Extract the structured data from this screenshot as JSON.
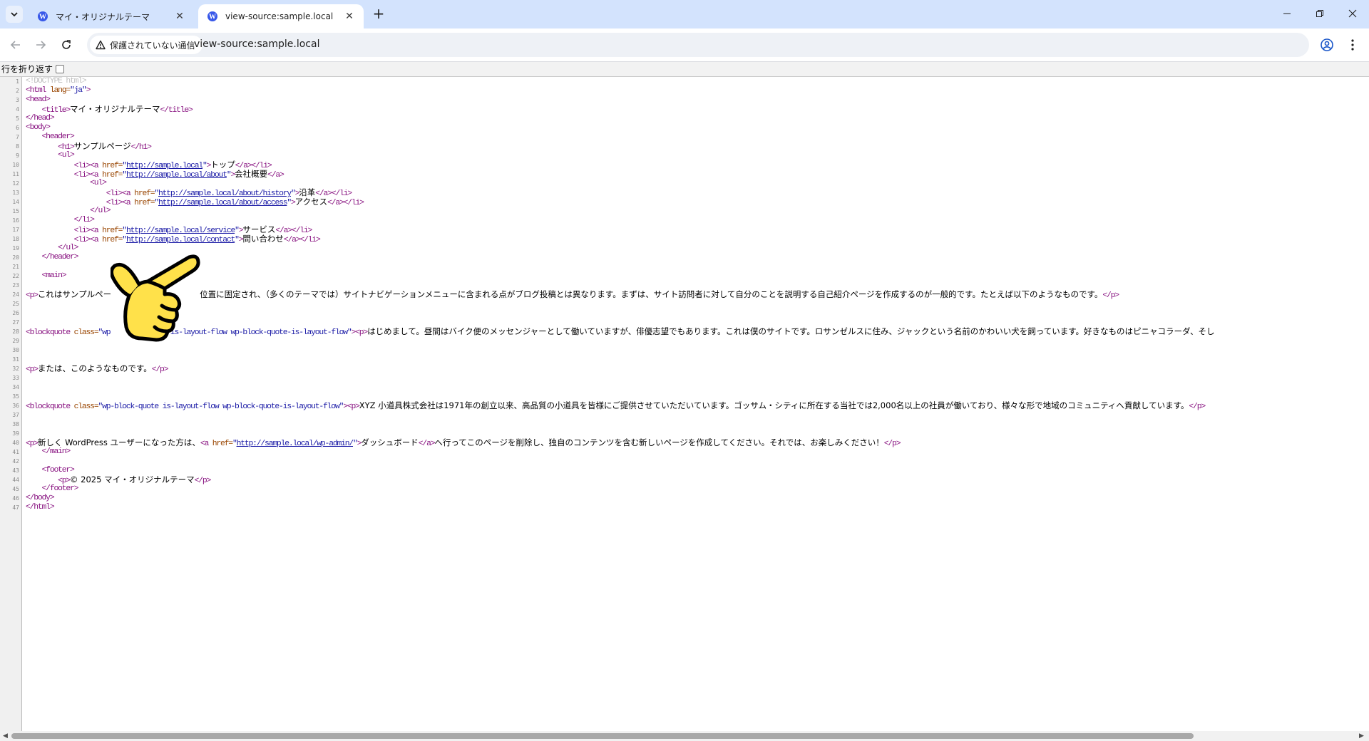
{
  "browser": {
    "tabs": [
      {
        "title": "マイ・オリジナルテーマ",
        "active": false
      },
      {
        "title": "view-source:sample.local",
        "active": true
      }
    ],
    "security_chip": "保護されていない通信",
    "url": "view-source:sample.local"
  },
  "wrap_label": "行を折り返す",
  "source_lines": [
    {
      "n": "1"
    },
    {
      "n": "2"
    },
    {
      "n": "3"
    },
    {
      "n": "4"
    },
    {
      "n": "5"
    },
    {
      "n": "6"
    },
    {
      "n": "7"
    },
    {
      "n": "8"
    },
    {
      "n": "9"
    },
    {
      "n": "10"
    },
    {
      "n": "11"
    },
    {
      "n": "12"
    },
    {
      "n": "13"
    },
    {
      "n": "14"
    },
    {
      "n": "15"
    },
    {
      "n": "16"
    },
    {
      "n": "17"
    },
    {
      "n": "18"
    },
    {
      "n": "19"
    },
    {
      "n": "20"
    },
    {
      "n": "21"
    },
    {
      "n": "22"
    },
    {
      "n": "23"
    },
    {
      "n": "24"
    },
    {
      "n": "25"
    },
    {
      "n": "26"
    },
    {
      "n": "27"
    },
    {
      "n": "28"
    },
    {
      "n": "29"
    },
    {
      "n": "30"
    },
    {
      "n": "31"
    },
    {
      "n": "32"
    },
    {
      "n": "33"
    },
    {
      "n": "34"
    },
    {
      "n": "35"
    },
    {
      "n": "36"
    },
    {
      "n": "37"
    },
    {
      "n": "38"
    },
    {
      "n": "39"
    },
    {
      "n": "40"
    },
    {
      "n": "41"
    },
    {
      "n": "42"
    },
    {
      "n": "43"
    },
    {
      "n": "44"
    },
    {
      "n": "45"
    },
    {
      "n": "46"
    },
    {
      "n": "47"
    }
  ],
  "src": {
    "doctype": "<!DOCTYPE html>",
    "html_open": "<html",
    "lang_attr": " lang=",
    "lang_val": "\"ja\"",
    "gt": ">",
    "head_open": "<head>",
    "title_open": "<title>",
    "title_text": "マイ・オリジナルテーマ",
    "title_close": "</title>",
    "head_close": "</head>",
    "body_open": "<body>",
    "header_open": "<header>",
    "h1_open": "<h1>",
    "h1_text": "サンプルページ",
    "h1_close": "</h1>",
    "ul_open": "<ul>",
    "ul_close": "</ul>",
    "li_open": "<li>",
    "li_close": "</li>",
    "a_open": "<a",
    "href_attr": " href=",
    "quote": "\"",
    "a_close": "</a>",
    "link_top": "http://sample.local",
    "text_top": "トップ",
    "link_about": "http://sample.local/about",
    "text_about": "会社概要",
    "link_history": "http://sample.local/about/history",
    "text_history": "沿革",
    "link_access": "http://sample.local/about/access",
    "text_access": "アクセス",
    "link_service": "http://sample.local/service",
    "text_service": "サービス",
    "link_contact": "http://sample.local/contact",
    "text_contact": "問い合わせ",
    "header_close": "</header>",
    "main_open": "<main>",
    "p_open": "<p>",
    "p_close": "</p>",
    "p24_text_a": "これはサンプルペー",
    "p24_text_b": "位置に固定され、（多くのテーマでは）サイトナビゲーションメニューに含まれる点がブログ投稿とは異なります。まずは、サイト訪問者に対して自分のことを説明する自己紹介ページを作成するのが一般的です。たとえば以下のようなものです。",
    "bq_open": "<blockquote",
    "class_attr": " class=",
    "bq28_class_a": "\"wp",
    "bq28_class_b": "ote is-layout-flow wp-block-quote-is-layout-flow\"",
    "bq28_text": "はじめまして。昼間はバイク便のメッセンジャーとして働いていますが、俳優志望でもあります。これは僕のサイトです。ロサンゼルスに住み、ジャックという名前のかわいい犬を飼っています。好きなものはピニャコラーダ、そし",
    "p32_text": "または、このようなものです。",
    "bq36_class": "\"wp-block-quote is-layout-flow wp-block-quote-is-layout-flow\"",
    "bq36_text": "XYZ 小道具株式会社は1971年の創立以来、高品質の小道具を皆様にご提供させていただいています。ゴッサム・シティに所在する当社では2,000名以上の社員が働いており、様々な形で地域のコミュニティへ貢献しています。",
    "p40_text_a": "新しく WordPress ユーザーになった方は、",
    "link_admin": "http://sample.local/wp-admin/",
    "p40_link_text": "ダッシュボード",
    "p40_text_b": "へ行ってこのページを削除し、独自のコンテンツを含む新しいページを作成してください。それでは、お楽しみください！",
    "main_close": "</main>",
    "footer_open": "<footer>",
    "footer_text": "© 2025 マイ・オリジナルテーマ",
    "footer_close": "</footer>",
    "body_close": "</body>",
    "html_close": "</html>"
  }
}
